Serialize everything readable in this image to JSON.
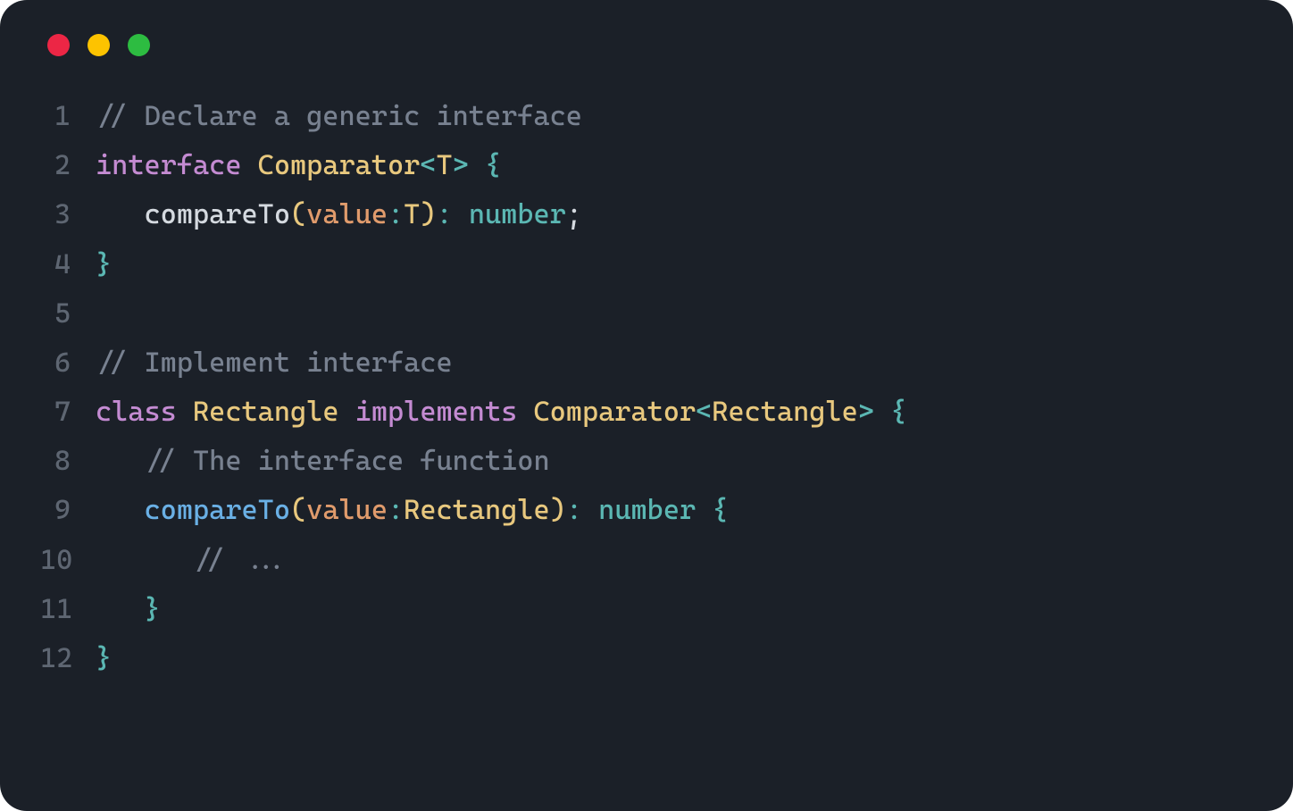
{
  "lines": [
    {
      "num": "1",
      "tokens": [
        {
          "cls": "tok-comment",
          "text": "// Declare a generic interface"
        }
      ],
      "indent": 0
    },
    {
      "num": "2",
      "tokens": [
        {
          "cls": "tok-keyword",
          "text": "interface"
        },
        {
          "cls": "",
          "text": " "
        },
        {
          "cls": "tok-classname",
          "text": "Comparator"
        },
        {
          "cls": "tok-punct-angle",
          "text": "<"
        },
        {
          "cls": "tok-type-param",
          "text": "T"
        },
        {
          "cls": "tok-punct-angle",
          "text": ">"
        },
        {
          "cls": "",
          "text": " "
        },
        {
          "cls": "tok-brace",
          "text": "{"
        }
      ],
      "indent": 0
    },
    {
      "num": "3",
      "tokens": [
        {
          "cls": "",
          "text": "compareTo"
        },
        {
          "cls": "tok-paren",
          "text": "("
        },
        {
          "cls": "tok-param",
          "text": "value"
        },
        {
          "cls": "tok-colon",
          "text": ":"
        },
        {
          "cls": "tok-type-param",
          "text": "T"
        },
        {
          "cls": "tok-paren",
          "text": ")"
        },
        {
          "cls": "tok-colon",
          "text": ":"
        },
        {
          "cls": "",
          "text": " "
        },
        {
          "cls": "tok-type-number",
          "text": "number"
        },
        {
          "cls": "tok-punct",
          "text": ";"
        }
      ],
      "indent": 1
    },
    {
      "num": "4",
      "tokens": [
        {
          "cls": "tok-brace",
          "text": "}"
        }
      ],
      "indent": 0
    },
    {
      "num": "5",
      "tokens": [],
      "indent": 0
    },
    {
      "num": "6",
      "tokens": [
        {
          "cls": "tok-comment",
          "text": "// Implement interface"
        }
      ],
      "indent": 0
    },
    {
      "num": "7",
      "tokens": [
        {
          "cls": "tok-keyword",
          "text": "class"
        },
        {
          "cls": "",
          "text": " "
        },
        {
          "cls": "tok-classname",
          "text": "Rectangle"
        },
        {
          "cls": "",
          "text": " "
        },
        {
          "cls": "tok-keyword",
          "text": "implements"
        },
        {
          "cls": "",
          "text": " "
        },
        {
          "cls": "tok-classname",
          "text": "Comparator"
        },
        {
          "cls": "tok-punct-angle",
          "text": "<"
        },
        {
          "cls": "tok-classname",
          "text": "Rectangle"
        },
        {
          "cls": "tok-punct-angle",
          "text": ">"
        },
        {
          "cls": "",
          "text": " "
        },
        {
          "cls": "tok-brace",
          "text": "{"
        }
      ],
      "indent": 0
    },
    {
      "num": "8",
      "tokens": [
        {
          "cls": "tok-comment",
          "text": "// The interface function"
        }
      ],
      "indent": 1
    },
    {
      "num": "9",
      "tokens": [
        {
          "cls": "tok-method",
          "text": "compareTo"
        },
        {
          "cls": "tok-paren",
          "text": "("
        },
        {
          "cls": "tok-param",
          "text": "value"
        },
        {
          "cls": "tok-colon",
          "text": ":"
        },
        {
          "cls": "tok-classname",
          "text": "Rectangle"
        },
        {
          "cls": "tok-paren",
          "text": ")"
        },
        {
          "cls": "tok-colon",
          "text": ":"
        },
        {
          "cls": "",
          "text": " "
        },
        {
          "cls": "tok-type-number",
          "text": "number"
        },
        {
          "cls": "",
          "text": " "
        },
        {
          "cls": "tok-brace",
          "text": "{"
        }
      ],
      "indent": 1
    },
    {
      "num": "10",
      "tokens": [
        {
          "cls": "tok-comment",
          "text": "// ..."
        }
      ],
      "indent": 2
    },
    {
      "num": "11",
      "tokens": [
        {
          "cls": "tok-brace",
          "text": "}"
        }
      ],
      "indent": 1
    },
    {
      "num": "12",
      "tokens": [
        {
          "cls": "tok-brace",
          "text": "}"
        }
      ],
      "indent": 0
    }
  ],
  "indent_unit": "   "
}
